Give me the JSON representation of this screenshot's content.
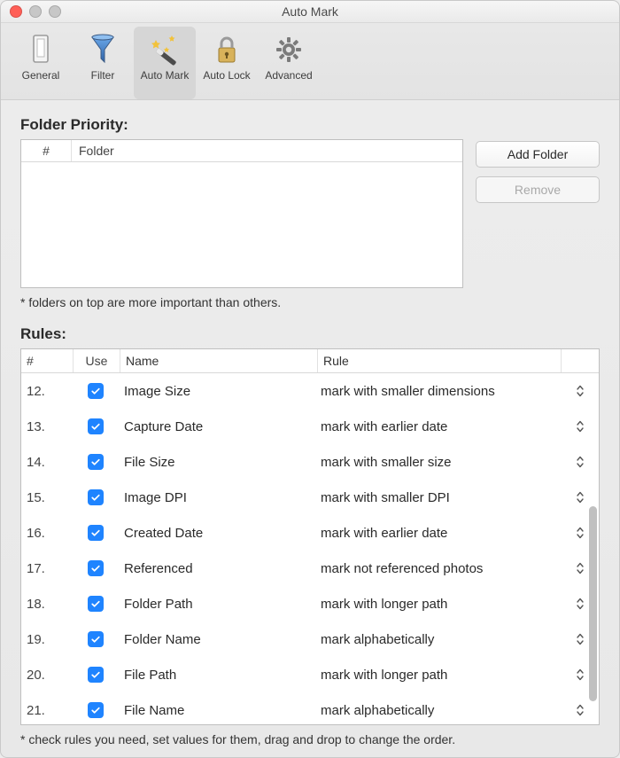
{
  "window": {
    "title": "Auto Mark"
  },
  "toolbar": {
    "items": [
      {
        "id": "general",
        "label": "General"
      },
      {
        "id": "filter",
        "label": "Filter"
      },
      {
        "id": "automark",
        "label": "Auto Mark"
      },
      {
        "id": "autolock",
        "label": "Auto Lock"
      },
      {
        "id": "advanced",
        "label": "Advanced"
      }
    ],
    "selected": "automark"
  },
  "folder": {
    "title": "Folder Priority:",
    "columns": {
      "num": "#",
      "folder": "Folder"
    },
    "add_label": "Add Folder",
    "remove_label": "Remove",
    "hint": "* folders on top are more important than others."
  },
  "rules": {
    "title": "Rules:",
    "columns": {
      "num": "#",
      "use": "Use",
      "name": "Name",
      "rule": "Rule"
    },
    "hint": "* check rules you need, set values for them, drag and drop to change the order.",
    "rows": [
      {
        "num": "12.",
        "use": true,
        "name": "Image Size",
        "rule": "mark with smaller dimensions"
      },
      {
        "num": "13.",
        "use": true,
        "name": "Capture Date",
        "rule": "mark with earlier date"
      },
      {
        "num": "14.",
        "use": true,
        "name": "File Size",
        "rule": "mark with smaller size"
      },
      {
        "num": "15.",
        "use": true,
        "name": "Image DPI",
        "rule": "mark with smaller DPI"
      },
      {
        "num": "16.",
        "use": true,
        "name": "Created Date",
        "rule": "mark with earlier date"
      },
      {
        "num": "17.",
        "use": true,
        "name": "Referenced",
        "rule": "mark not referenced photos"
      },
      {
        "num": "18.",
        "use": true,
        "name": "Folder Path",
        "rule": "mark with longer path"
      },
      {
        "num": "19.",
        "use": true,
        "name": "Folder Name",
        "rule": "mark alphabetically"
      },
      {
        "num": "20.",
        "use": true,
        "name": "File Path",
        "rule": "mark with longer path"
      },
      {
        "num": "21.",
        "use": true,
        "name": "File Name",
        "rule": "mark alphabetically"
      }
    ]
  }
}
